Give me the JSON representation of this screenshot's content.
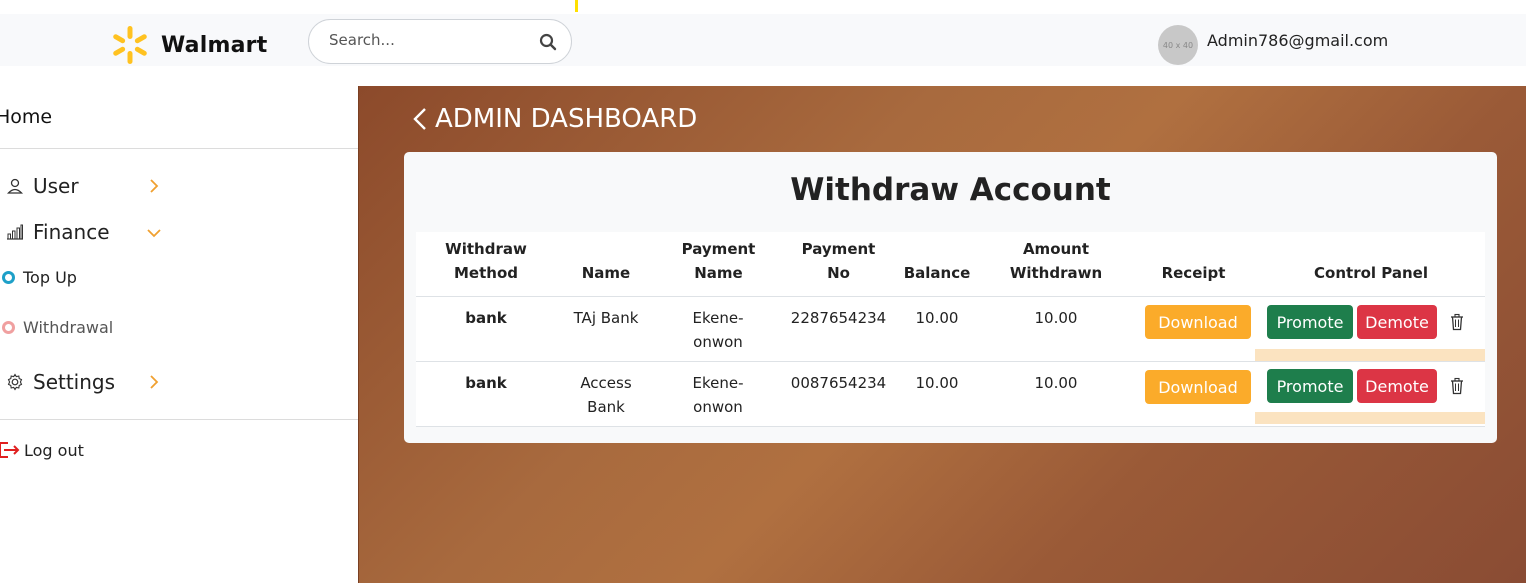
{
  "header": {
    "brand": "Walmart",
    "search_placeholder": "Search...",
    "avatar_text": "40 x 40",
    "user_email": "Admin786@gmail.com"
  },
  "sidebar": {
    "home": "Home",
    "user": "User",
    "finance": "Finance",
    "top_up": "Top Up",
    "withdrawal": "Withdrawal",
    "settings": "Settings",
    "logout": "Log out"
  },
  "dashboard": {
    "title": "ADMIN DASHBOARD",
    "card_title": "Withdraw Account",
    "columns": [
      "Withdraw Method",
      "Name",
      "Payment Name",
      "Payment No",
      "Balance",
      "Amount Withdrawn",
      "Receipt",
      "Control Panel"
    ],
    "rows": [
      {
        "method": "bank",
        "name": "TAj Bank",
        "payment_name": "Ekene-onwon",
        "payment_no": "2287654234",
        "balance": "10.00",
        "withdrawn": "10.00"
      },
      {
        "method": "bank",
        "name": "Access Bank",
        "payment_name": "Ekene-onwon",
        "payment_no": "0087654234",
        "balance": "10.00",
        "withdrawn": "10.00"
      }
    ],
    "download_label": "Download",
    "promote_label": "Promote",
    "demote_label": "Demote"
  },
  "colors": {
    "download": "#fbab2a",
    "promote": "#1e7e4c",
    "demote": "#dc3545",
    "brand_spark": "#ffc220"
  }
}
